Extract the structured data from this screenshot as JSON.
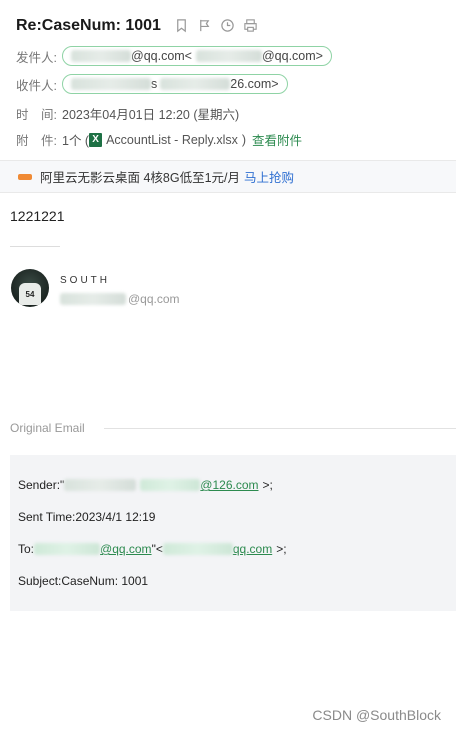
{
  "header": {
    "subject": "Re:CaseNum: 1001",
    "icons": [
      "bookmark-icon",
      "flag-icon",
      "clock-icon",
      "print-icon"
    ],
    "from_label": "发件人:",
    "from_value": "@qq.com<",
    "from_value_tail": "@qq.com>",
    "to_label": "收件人:",
    "to_value_mid": "s",
    "to_value_tail": "26.com>",
    "time_label": "时　间:",
    "time_value": "2023年04月01日 12:20 (星期六)",
    "attach_label": "附　件:",
    "attach_count": "1个 (",
    "attach_name": "AccountList - Reply.xlsx",
    "attach_close": ")",
    "attach_view": "查看附件"
  },
  "ad": {
    "text": "阿里云无影云桌面 4核8G低至1元/月",
    "link": "马上抢购"
  },
  "body": {
    "text": "1221221"
  },
  "signature": {
    "name": "SOUTH",
    "email": "@qq.com",
    "avatar_text": "54"
  },
  "original": {
    "label": "Original Email",
    "sender_label": "Sender:\"",
    "sender_link": "@126.com",
    "sender_tail": ">;",
    "sent_label": "Sent Time:",
    "sent_value": "2023/4/1 12:19",
    "to_label": "To:",
    "to_link1": "@qq.com",
    "to_mid": "\"<",
    "to_link2": "qq.com",
    "to_tail": ">;",
    "subject_label": "Subject:",
    "subject_value": "CaseNum: 1001"
  },
  "watermark": "CSDN @SouthBlock"
}
